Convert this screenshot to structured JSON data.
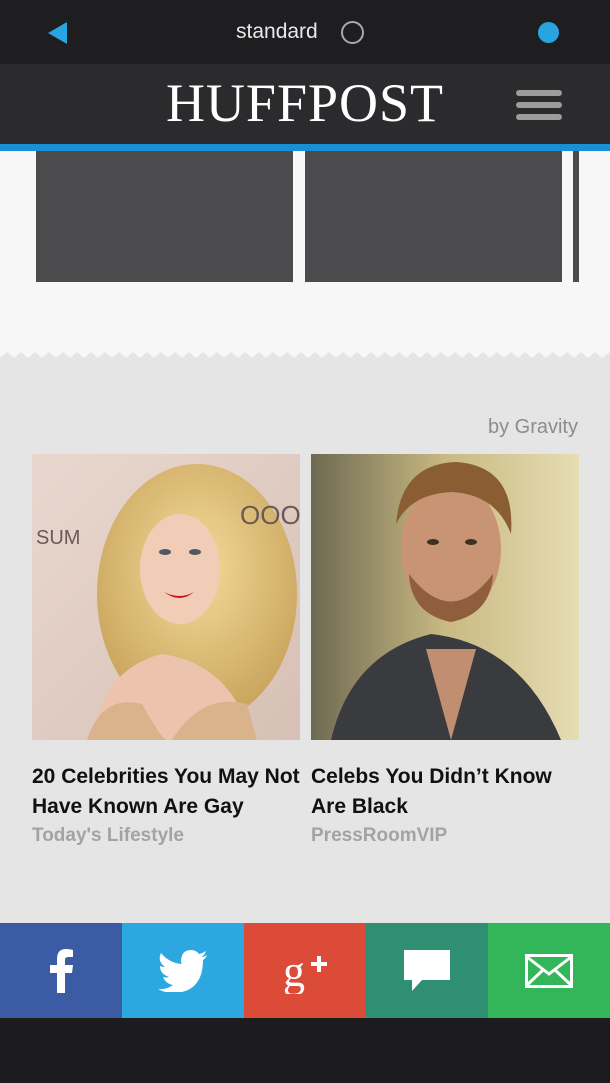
{
  "statusbar": {
    "mode_label": "standard",
    "accent_color": "#2aa3e1"
  },
  "header": {
    "logo": "HUFFPOST",
    "accent_line_color": "#1a8fd6"
  },
  "sponsored": {
    "provider_label": "by Gravity",
    "cards": [
      {
        "title": "20 Celebrities You May Not Have Known Are Gay",
        "source": "Today's Lifestyle"
      },
      {
        "title": "Celebs You Didn’t Know Are Black",
        "source": "PressRoomVIP"
      }
    ]
  },
  "share": {
    "items": [
      {
        "name": "facebook",
        "icon": "facebook-icon",
        "color": "#3b5ba5"
      },
      {
        "name": "twitter",
        "icon": "twitter-icon",
        "color": "#2ca7e0"
      },
      {
        "name": "google-plus",
        "icon": "google-plus-icon",
        "color": "#dc4a38"
      },
      {
        "name": "comment",
        "icon": "comment-icon",
        "color": "#2f8f73"
      },
      {
        "name": "email",
        "icon": "envelope-icon",
        "color": "#33b55a"
      }
    ]
  }
}
